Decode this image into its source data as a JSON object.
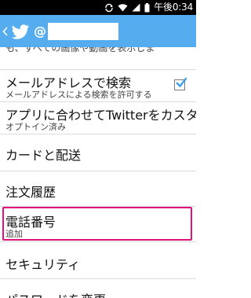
{
  "status_bar": {
    "time": "午後0:34",
    "icons": [
      "wifi-icon",
      "signal-icon",
      "battery-icon",
      "sync-icon"
    ]
  },
  "action_bar": {
    "account_prefix": "@",
    "background_color": "#55acee"
  },
  "list": {
    "partial_text": "も、すべての画像や動画を表示しま",
    "items": [
      {
        "title": "メールアドレスで検索",
        "subtitle": "メールアドレスによる検索を許可する",
        "checked": true
      },
      {
        "title": "アプリに合わせてTwitterをカスタ..",
        "subtitle": "オプトイン済み"
      },
      {
        "title": "カードと配送"
      },
      {
        "title": "注文履歴"
      },
      {
        "title": "電話番号",
        "subtitle": "追加",
        "highlighted": true
      },
      {
        "title": "セキュリティ"
      },
      {
        "title": "パスワードを変更"
      }
    ]
  },
  "colors": {
    "highlight": "#e0127b",
    "checkbox": "#3aa0e8"
  }
}
